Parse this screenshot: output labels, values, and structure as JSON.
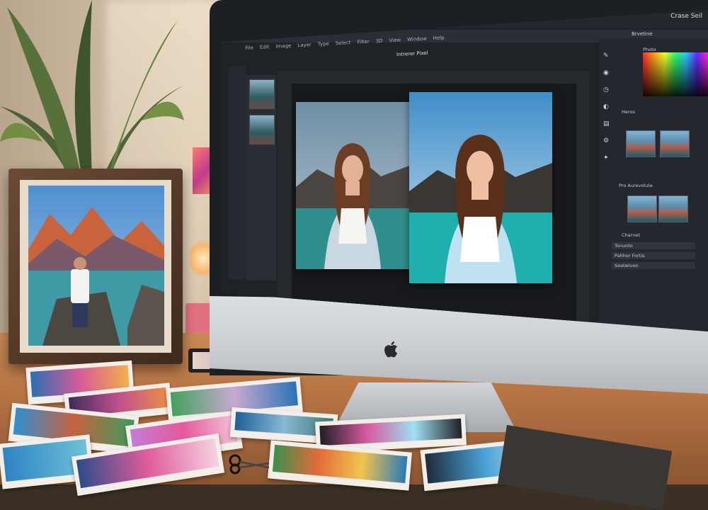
{
  "scene": "photo",
  "screen": {
    "os_menu": "Crase  Seil",
    "app_menu": [
      "File",
      "Edit",
      "Image",
      "Layer",
      "Type",
      "Select",
      "Filter",
      "3D",
      "View",
      "Window",
      "Help"
    ],
    "document_title": "Intrerer Pixel",
    "panel_tab": "Brvetine",
    "panels": [
      {
        "title": "Photo"
      },
      {
        "title": "Heros"
      },
      {
        "title": "Pro Aurevolute"
      },
      {
        "title": "Charnet"
      }
    ],
    "layer_rows": [
      "Tonunto",
      "Pahhor Fortis",
      "Seatwiven"
    ]
  },
  "colors": {
    "accent": "#4aa3d8",
    "panel_bg": "#24282e"
  }
}
